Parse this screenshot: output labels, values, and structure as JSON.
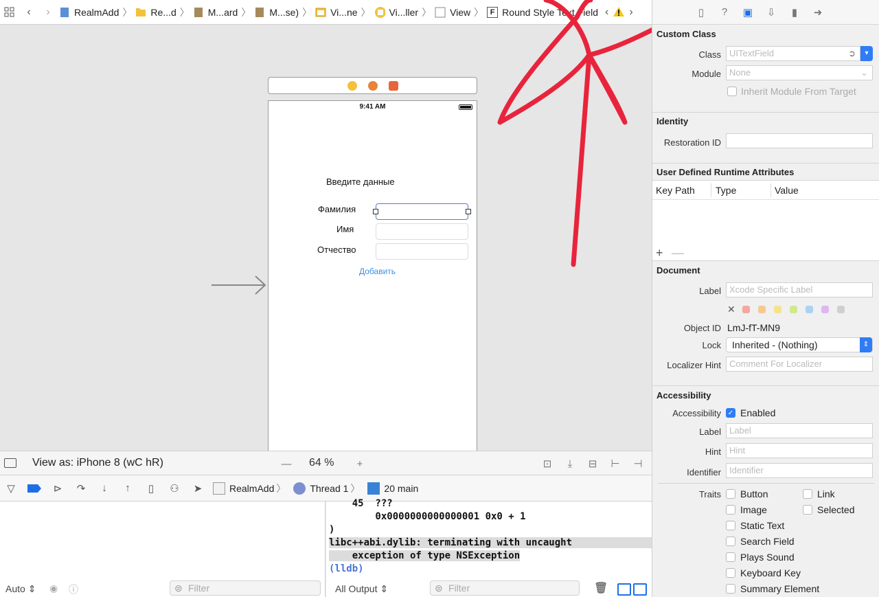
{
  "jumpbar": {
    "crumbs": [
      "RealmAdd",
      "Re...d",
      "M...ard",
      "M...se)",
      "Vi...ne",
      "Vi...ller",
      "View",
      "Round Style Text Field"
    ],
    "warning_icon": "warning-icon"
  },
  "canvas": {
    "status_time": "9:41 AM",
    "title": "Введите данные",
    "labels": [
      "Фамилия",
      "Имя",
      "Отчество"
    ],
    "add_button": "Добавить",
    "view_as": "View as: iPhone 8 (wC hR)",
    "zoom": "64 %"
  },
  "debug": {
    "crumbs": [
      "RealmAdd",
      "Thread 1",
      "20 main"
    ]
  },
  "console": {
    "lines": [
      "    45  ???",
      "        0x0000000000000001 0x0 + 1",
      ")",
      "libc++abi.dylib: terminating with uncaught",
      "    exception of type NSException",
      "(lldb)"
    ],
    "output_select": "All Output",
    "filter_placeholder": "Filter",
    "vars_scope": "Auto",
    "vars_filter_placeholder": "Filter"
  },
  "inspector": {
    "custom_class": {
      "title": "Custom Class",
      "class_label": "Class",
      "class_value": "UITextField",
      "module_label": "Module",
      "module_value": "None",
      "inherit_label": "Inherit Module From Target"
    },
    "identity": {
      "title": "Identity",
      "restoration_label": "Restoration ID",
      "restoration_value": ""
    },
    "runtime_attrs": {
      "title": "User Defined Runtime Attributes",
      "columns": [
        "Key Path",
        "Type",
        "Value"
      ]
    },
    "document": {
      "title": "Document",
      "label_label": "Label",
      "label_placeholder": "Xcode Specific Label",
      "object_id_label": "Object ID",
      "object_id_value": "LmJ-fT-MN9",
      "lock_label": "Lock",
      "lock_value": "Inherited - (Nothing)",
      "hint_label": "Localizer Hint",
      "hint_placeholder": "Comment For Localizer",
      "swatch_colors": [
        "#f5a7a0",
        "#f7c98e",
        "#f5e38a",
        "#d2e88c",
        "#a9d3f5",
        "#dcb8f0",
        "#cfcfcf"
      ]
    },
    "accessibility": {
      "title": "Accessibility",
      "acc_label": "Accessibility",
      "enabled_label": "Enabled",
      "label_label": "Label",
      "label_placeholder": "Label",
      "hint_label": "Hint",
      "hint_placeholder": "Hint",
      "identifier_label": "Identifier",
      "identifier_placeholder": "Identifier",
      "traits_label": "Traits",
      "traits_left": [
        "Button",
        "Image",
        "Static Text",
        "Search Field",
        "Plays Sound",
        "Keyboard Key",
        "Summary Element"
      ],
      "traits_right": [
        "Link",
        "Selected"
      ]
    }
  },
  "colors": {
    "accent": "#1e6fe5",
    "scribble": "#e8243c",
    "link": "#3a8ee6"
  }
}
